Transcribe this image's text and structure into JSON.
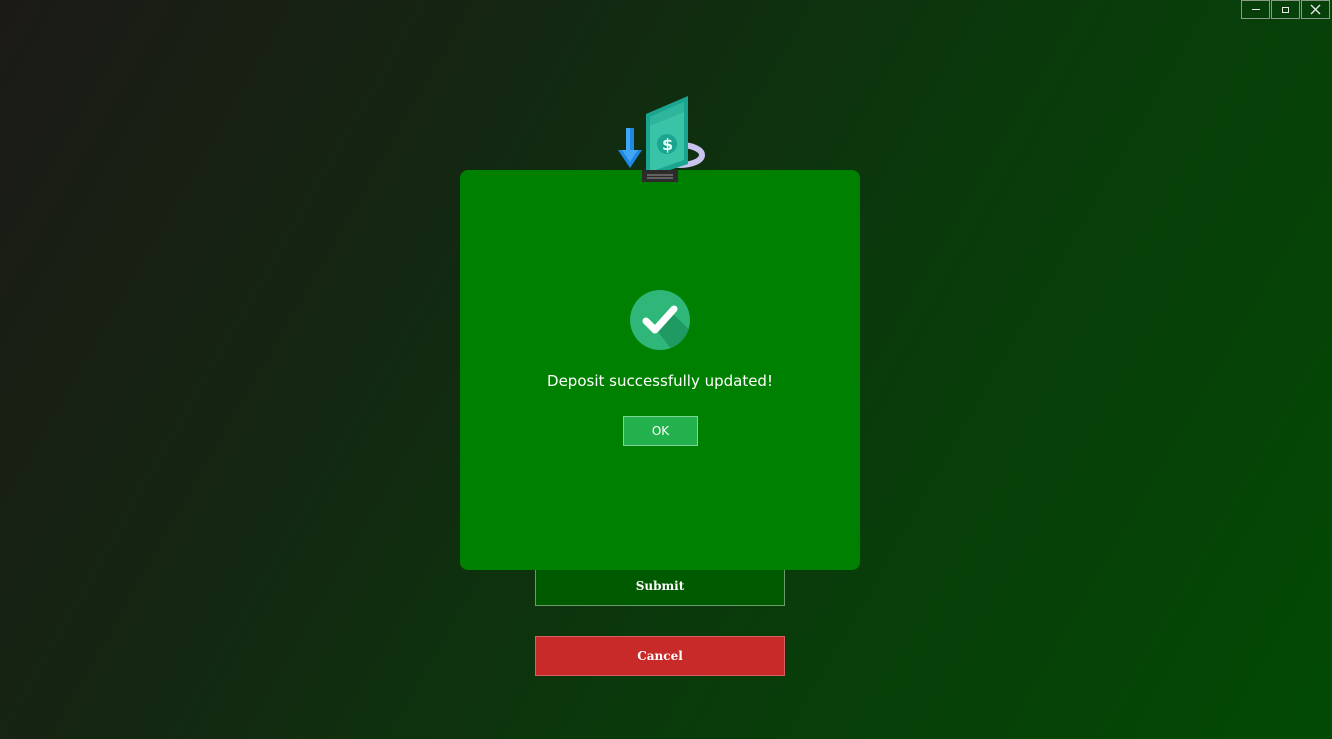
{
  "window_controls": {
    "minimize_icon": "minimize-icon",
    "maximize_icon": "maximize-icon",
    "close_icon": "close-icon"
  },
  "form": {
    "submit_label": "Submit",
    "cancel_label": "Cancel"
  },
  "dialog": {
    "illustration_icon": "deposit-money-icon",
    "status_icon": "success-check-icon",
    "message": "Deposit successfully updated!",
    "ok_label": "OK"
  },
  "colors": {
    "dialog_background": "#008000",
    "ok_button": "#22b14c",
    "submit_button": "#005a00",
    "cancel_button": "#c82a2a",
    "success_icon": "#2fb77a"
  }
}
